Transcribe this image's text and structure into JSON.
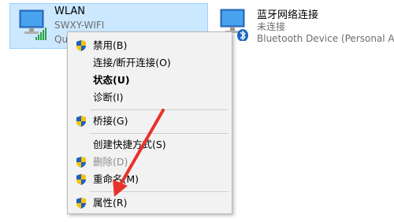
{
  "adapters": {
    "wlan": {
      "name": "WLAN",
      "ssid": "SWXY-WIFI",
      "status_partial": "Qu",
      "icon": "wifi-signal-icon",
      "selected": true
    },
    "bluetooth": {
      "name": "蓝牙网络连接",
      "status": "未连接",
      "device": "Bluetooth Device (Personal Are",
      "icon": "bluetooth-network-icon"
    }
  },
  "context_menu": {
    "items": [
      {
        "label": "禁用(B)",
        "icon": "uac-shield-icon"
      },
      {
        "label": "连接/断开连接(O)"
      },
      {
        "label": "状态(U)",
        "bold": true
      },
      {
        "label": "诊断(I)"
      },
      {
        "label": "桥接(G)",
        "icon": "uac-shield-icon"
      },
      {
        "label": "创建快捷方式(S)"
      },
      {
        "label": "删除(D)",
        "icon": "uac-shield-icon",
        "disabled": true
      },
      {
        "label": "重命名(M)",
        "icon": "uac-shield-icon"
      },
      {
        "label": "属性(R)",
        "icon": "uac-shield-icon"
      }
    ]
  },
  "colors": {
    "selection_fill": "#cce8ff",
    "selection_border": "#99d1ff",
    "menu_background": "#f2f2f2",
    "annotation_arrow": "#e8322b",
    "disabled_text": "#8d8d8d"
  }
}
